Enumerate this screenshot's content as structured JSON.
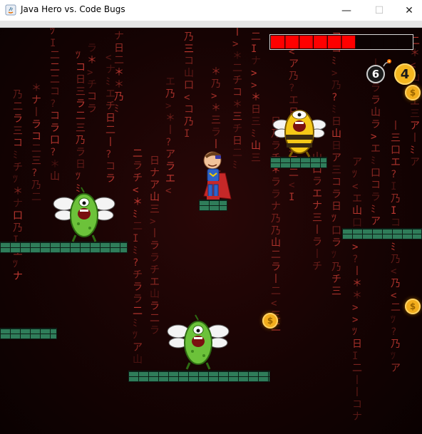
{
  "window": {
    "title": "Java Hero vs. Code Bugs",
    "minimize_glyph": "—",
    "maximize_glyph": "☐",
    "close_glyph": "✕"
  },
  "hud": {
    "health_fraction": 0.6,
    "health_segments": 10,
    "bombs": "6",
    "coins": "4"
  },
  "coin_symbol": "$",
  "colors": {
    "background": "#1a0404",
    "matrix_text": "#e0433a",
    "platform": "#2f7d5a",
    "health": "#ff0000",
    "coin": "#f2ad1c"
  },
  "sprites": {
    "hero": "java-hero",
    "enemies": [
      "green-bug",
      "green-bug",
      "yellow-bug"
    ]
  }
}
